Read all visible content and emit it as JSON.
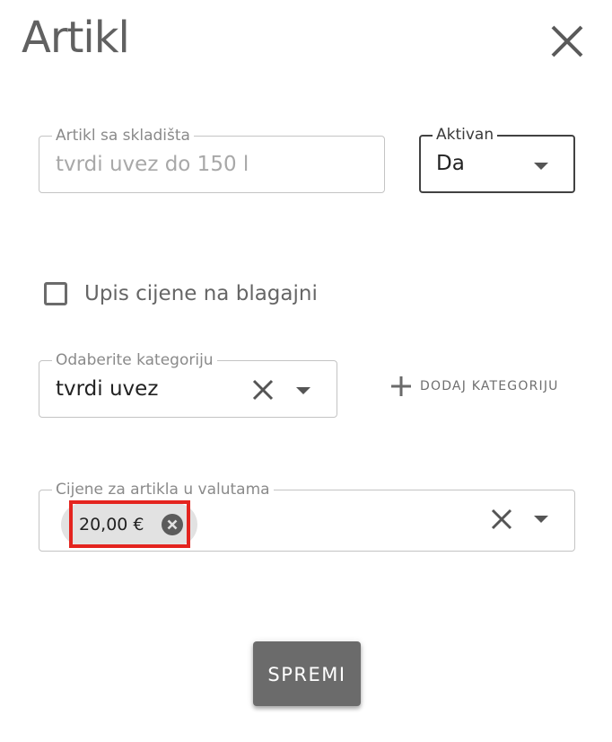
{
  "dialog": {
    "title": "Artikl",
    "close_icon": "close-icon"
  },
  "warehouse_item": {
    "label": "Artikl sa skladišta",
    "value": "tvrdi uvez do 150 l",
    "disabled": true
  },
  "active": {
    "label": "Aktivan",
    "value": "Da",
    "dropdown_icon": "arrow-drop-down-icon"
  },
  "price_entry": {
    "label": "Upis cijene na blagajni",
    "checked": false
  },
  "category": {
    "label": "Odaberite kategoriju",
    "value": "tvrdi uvez",
    "clear_icon": "clear-icon",
    "dropdown_icon": "arrow-drop-down-icon"
  },
  "add_category": {
    "icon": "plus-icon",
    "label": "DODAJ KATEGORIJU"
  },
  "currency_prices": {
    "label": "Cijene za artikla u valutama",
    "chips": [
      {
        "label": "20,00 €",
        "delete_icon": "cancel-circle-icon",
        "highlighted": true
      }
    ],
    "clear_icon": "clear-icon",
    "dropdown_icon": "arrow-drop-down-icon"
  },
  "save_button": {
    "label": "SPREMI"
  },
  "colors": {
    "highlight": "#e4241f",
    "button_bg": "#6b6b6b",
    "chip_bg": "#e2e2e2",
    "text_primary": "#222222",
    "text_muted": "#8a8a8a"
  }
}
